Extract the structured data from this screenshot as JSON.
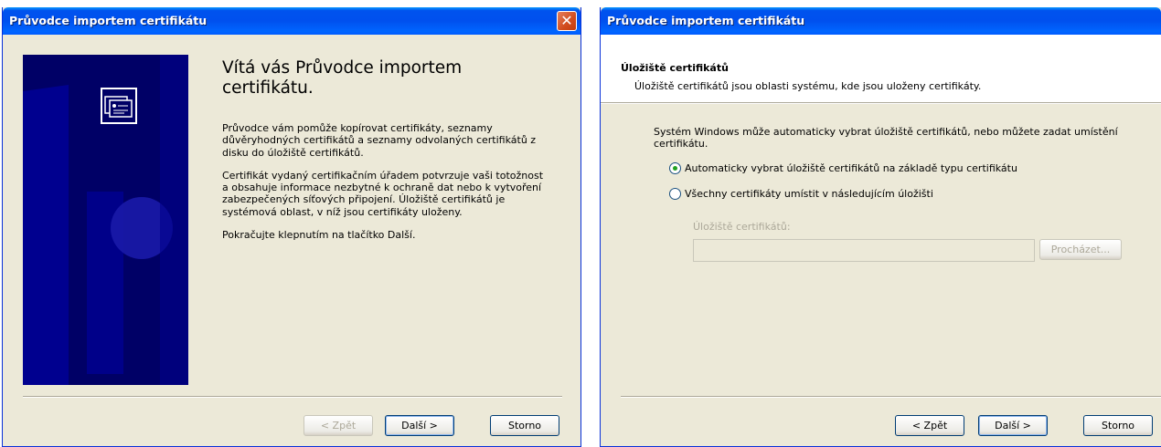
{
  "left_dialog": {
    "title": "Průvodce importem certifikátu",
    "welcome_title": "Vítá vás Průvodce importem certifikátu.",
    "para1": "Průvodce vám pomůže kopírovat certifikáty, seznamy důvěryhodných certifikátů a seznamy odvolaných certifikátů z disku do úložiště certifikátů.",
    "para2": "Certifikát vydaný certifikačním úřadem potvrzuje vaši totožnost a obsahuje informace nezbytné k ochraně dat nebo k vytvoření zabezpečených síťových připojení. Úložiště certifikátů je systémová oblast, v níž jsou certifikáty uloženy.",
    "para3": "Pokračujte klepnutím na tlačítko Další.",
    "buttons": {
      "back": "< Zpět",
      "next": "Další >",
      "cancel": "Storno"
    }
  },
  "right_dialog": {
    "title": "Průvodce importem certifikátu",
    "header_title": "Úložiště certifikátů",
    "header_subtitle": "Úložiště certifikátů jsou oblasti systému, kde jsou uloženy certifikáty.",
    "intro": "Systém Windows může automaticky vybrat úložiště certifikátů, nebo můžete zadat umístění certifikátu.",
    "radio_auto": {
      "label": "Automaticky vybrat úložiště certifikátů na základě typu certifikátu",
      "checked": true
    },
    "radio_manual": {
      "label": "Všechny certifikáty umístit v následujícím úložišti",
      "checked": false
    },
    "store_label": "Úložiště certifikátů:",
    "store_value": "",
    "browse": "Procházet...",
    "buttons": {
      "back": "< Zpět",
      "next": "Další >",
      "cancel": "Storno"
    }
  },
  "colors": {
    "titlebar": "#0058ee",
    "dialog_bg": "#ece9d8",
    "welcome_panel": "#000066"
  },
  "icons": [
    "close-icon",
    "certificate-icon",
    "radio-checked",
    "radio-unchecked"
  ]
}
